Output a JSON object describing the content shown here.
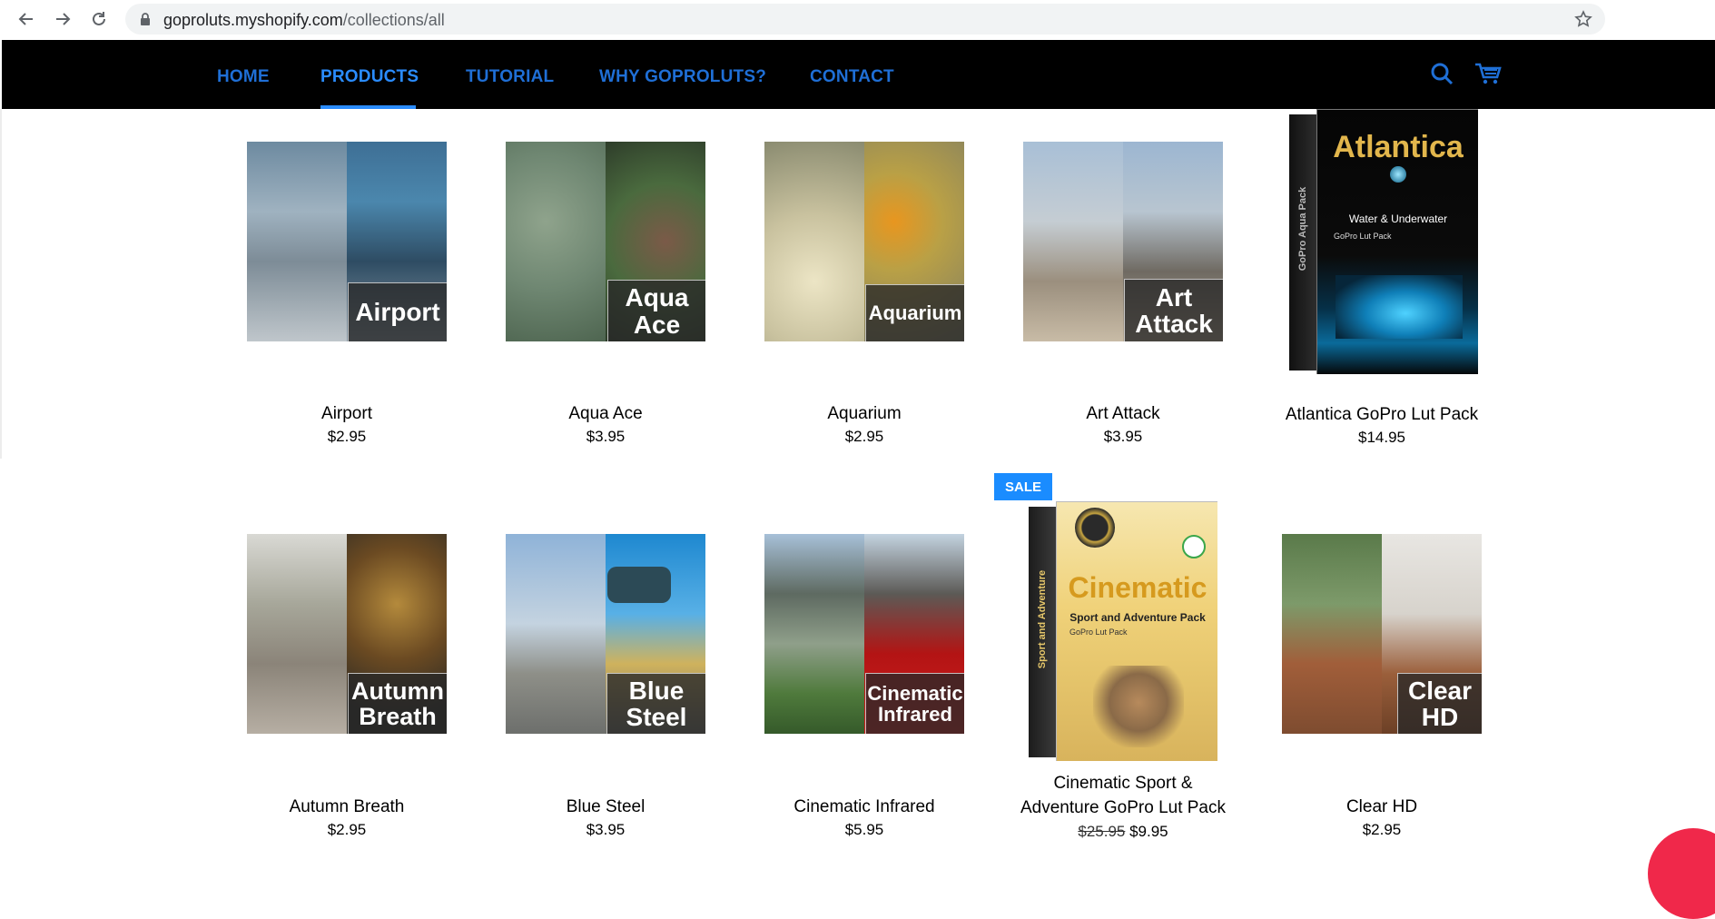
{
  "browser": {
    "url_host": "goproluts.myshopify.com",
    "url_path": "/collections/all"
  },
  "nav": {
    "items": [
      "HOME",
      "PRODUCTS",
      "TUTORIAL",
      "WHY GOPROLUTS?",
      "CONTACT"
    ],
    "active": "PRODUCTS"
  },
  "colors": {
    "accent": "#2a8cff",
    "nav_text": "#1f6fd6",
    "header_bg": "#000000",
    "sale": "#1a8cff"
  },
  "sale_badge": "SALE",
  "products": [
    {
      "name": "Airport",
      "price": "$2.95",
      "overlay": "Airport"
    },
    {
      "name": "Aqua Ace",
      "price": "$3.95",
      "overlay": "Aqua Ace"
    },
    {
      "name": "Aquarium",
      "price": "$2.95",
      "overlay": "Aquarium"
    },
    {
      "name": "Art Attack",
      "price": "$3.95",
      "overlay": "Art Attack"
    },
    {
      "name": "Atlantica GoPro Lut Pack",
      "price": "$14.95",
      "box_title": "Atlantica",
      "box_sub": "Water & Underwater",
      "box_small": "GoPro Lut Pack",
      "box_side": "GoPro Aqua Pack"
    },
    {
      "name": "Autumn Breath",
      "price": "$2.95",
      "overlay": "Autumn Breath"
    },
    {
      "name": "Blue Steel",
      "price": "$3.95",
      "overlay": "Blue Steel"
    },
    {
      "name": "Cinematic Infrared",
      "price": "$5.95",
      "overlay": "Cinematic Infrared"
    },
    {
      "name_line1": "Cinematic Sport &",
      "name_line2": "Adventure GoPro Lut Pack",
      "old_price": "$25.95",
      "price": "$9.95",
      "box_title": "Cinematic",
      "box_sub": "Sport and Adventure Pack",
      "box_small": "GoPro Lut Pack",
      "box_side": "Sport and Adventure"
    },
    {
      "name": "Clear HD",
      "price": "$2.95",
      "overlay_line1": "Clear",
      "overlay_line2": "HD"
    }
  ]
}
